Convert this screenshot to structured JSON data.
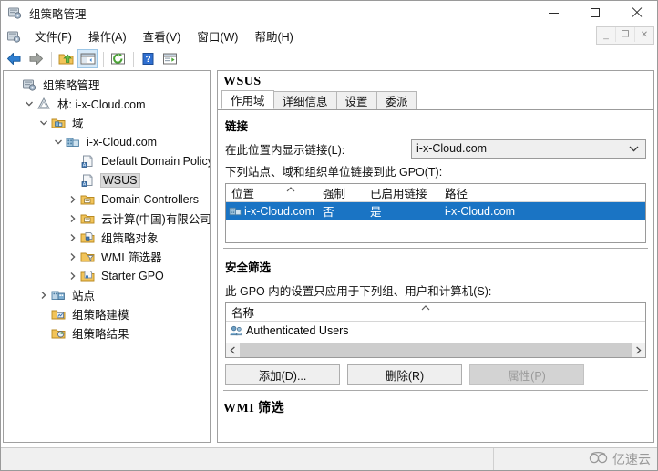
{
  "window": {
    "title": "组策略管理",
    "title_icon": "gpmc-console-icon",
    "controls": {
      "minimize": "–",
      "maximize": "□",
      "close": "✕"
    },
    "child_controls": {
      "minimize": "_",
      "restore": "❐",
      "close": "✕"
    }
  },
  "menubar": {
    "icon": "gpmc-console-icon",
    "items": [
      {
        "label": "文件(F)",
        "name": "menu-file"
      },
      {
        "label": "操作(A)",
        "name": "menu-action"
      },
      {
        "label": "查看(V)",
        "name": "menu-view"
      },
      {
        "label": "窗口(W)",
        "name": "menu-window"
      },
      {
        "label": "帮助(H)",
        "name": "menu-help"
      }
    ]
  },
  "toolbar": {
    "buttons": [
      {
        "name": "back-button",
        "icon": "arrow-left-icon",
        "pressed": false
      },
      {
        "name": "forward-button",
        "icon": "arrow-right-icon",
        "pressed": false
      },
      {
        "name": "up-one-level-button",
        "icon": "folder-up-icon",
        "pressed": false
      },
      {
        "name": "show-hide-tree-button",
        "icon": "console-tree-icon",
        "pressed": true
      },
      {
        "name": "refresh-button",
        "icon": "refresh-icon",
        "pressed": false
      },
      {
        "name": "help-button",
        "icon": "question-mark-icon",
        "pressed": false
      },
      {
        "name": "export-list-button",
        "icon": "export-list-icon",
        "pressed": false
      }
    ]
  },
  "tree": {
    "nodes": [
      {
        "label": "组策略管理",
        "depth": 0,
        "twist": "none",
        "icon": "gpmc-console-icon",
        "selected": false
      },
      {
        "label": "林: i-x-Cloud.com",
        "depth": 1,
        "twist": "expanded",
        "icon": "forest-icon",
        "selected": false
      },
      {
        "label": "域",
        "depth": 2,
        "twist": "expanded",
        "icon": "domains-folder-icon",
        "selected": false
      },
      {
        "label": "i-x-Cloud.com",
        "depth": 3,
        "twist": "expanded",
        "icon": "domain-icon",
        "selected": false
      },
      {
        "label": "Default Domain Policy",
        "depth": 4,
        "twist": "none",
        "icon": "gpo-link-icon",
        "selected": false
      },
      {
        "label": "WSUS",
        "depth": 4,
        "twist": "none",
        "icon": "gpo-link-icon",
        "selected": true
      },
      {
        "label": "Domain Controllers",
        "depth": 4,
        "twist": "collapsed",
        "icon": "ou-folder-icon",
        "selected": false
      },
      {
        "label": "云计算(中国)有限公司",
        "depth": 4,
        "twist": "collapsed",
        "icon": "ou-folder-icon",
        "selected": false
      },
      {
        "label": "组策略对象",
        "depth": 4,
        "twist": "collapsed",
        "icon": "gpo-container-icon",
        "selected": false
      },
      {
        "label": "WMI 筛选器",
        "depth": 4,
        "twist": "collapsed",
        "icon": "wmi-filters-icon",
        "selected": false
      },
      {
        "label": "Starter GPO",
        "depth": 4,
        "twist": "collapsed",
        "icon": "starter-gpo-icon",
        "selected": false
      },
      {
        "label": "站点",
        "depth": 2,
        "twist": "collapsed",
        "icon": "sites-icon",
        "selected": false
      },
      {
        "label": "组策略建模",
        "depth": 2,
        "twist": "none",
        "icon": "gp-modeling-icon",
        "selected": false
      },
      {
        "label": "组策略结果",
        "depth": 2,
        "twist": "none",
        "icon": "gp-results-icon",
        "selected": false
      }
    ]
  },
  "details": {
    "title": "WSUS",
    "tabs": [
      {
        "label": "作用域",
        "name": "tab-scope",
        "active": true
      },
      {
        "label": "详细信息",
        "name": "tab-details",
        "active": false
      },
      {
        "label": "设置",
        "name": "tab-settings",
        "active": false
      },
      {
        "label": "委派",
        "name": "tab-delegation",
        "active": false
      }
    ],
    "links_section": {
      "heading": "链接",
      "location_label": "在此位置内显示链接(L):",
      "location_value": "i-x-Cloud.com",
      "list_caption": "下列站点、域和组织单位链接到此 GPO(T):",
      "columns": [
        {
          "label": "位置",
          "name": "col-location",
          "sorted": true
        },
        {
          "label": "强制",
          "name": "col-enforced",
          "sorted": false
        },
        {
          "label": "已启用链接",
          "name": "col-link-enabled",
          "sorted": false
        },
        {
          "label": "路径",
          "name": "col-path",
          "sorted": false
        }
      ],
      "rows": [
        {
          "icon": "domain-icon",
          "location": "i-x-Cloud.com",
          "enforced": "否",
          "link_enabled": "是",
          "path": "i-x-Cloud.com",
          "selected": true
        }
      ]
    },
    "security_section": {
      "heading": "安全筛选",
      "caption": "此 GPO 内的设置只应用于下列组、用户和计算机(S):",
      "columns": [
        {
          "label": "名称",
          "name": "col-name",
          "sorted": true
        }
      ],
      "rows": [
        {
          "icon": "users-group-icon",
          "name": "Authenticated Users"
        }
      ],
      "buttons": [
        {
          "label": "添加(D)...",
          "name": "add-button",
          "disabled": false
        },
        {
          "label": "删除(R)",
          "name": "remove-button",
          "disabled": false
        },
        {
          "label": "属性(P)",
          "name": "properties-button",
          "disabled": true
        }
      ]
    },
    "wmi_section": {
      "heading": "WMI 筛选"
    }
  },
  "statusbar": {
    "left_text": "",
    "right_text": ""
  },
  "watermark": {
    "text": "亿速云",
    "icon": "cloud-logo-icon"
  },
  "colors": {
    "selection_blue": "#1a74c4",
    "tree_selection_gray": "#d9d9d9",
    "toolbar_pressed": "#d6e9f8",
    "panel_border": "#a0a0a0",
    "button_face": "#efefef",
    "disabled_button": "#d3d3d3"
  }
}
